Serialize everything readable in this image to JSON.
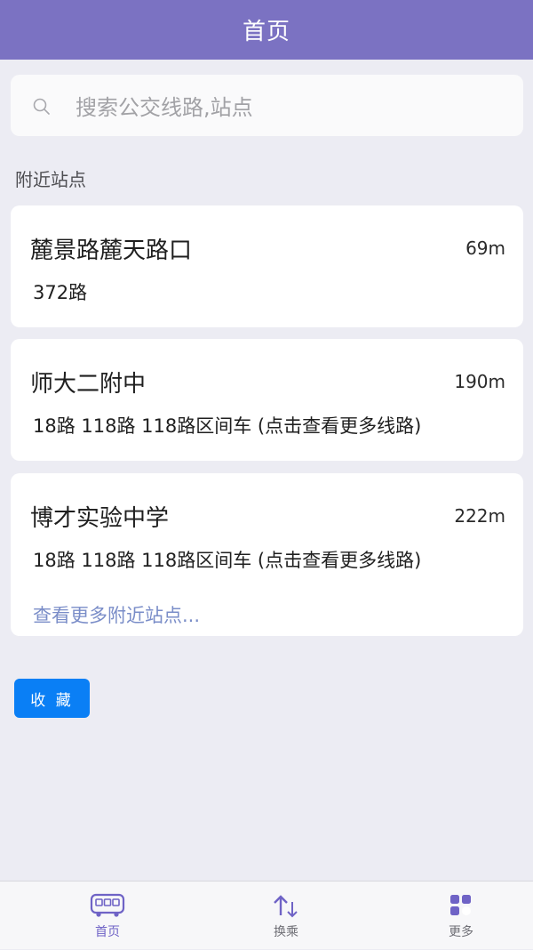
{
  "header": {
    "title": "首页"
  },
  "search": {
    "placeholder": "搜索公交线路,站点"
  },
  "nearby": {
    "section_label": "附近站点",
    "stops": [
      {
        "name": "麓景路麓天路口",
        "distance": "69m",
        "routes": "372路"
      },
      {
        "name": "师大二附中",
        "distance": "190m",
        "routes": "18路 118路 118路区间车 (点击查看更多线路)"
      },
      {
        "name": "博才实验中学",
        "distance": "222m",
        "routes": "18路 118路 118路区间车 (点击查看更多线路)"
      }
    ],
    "more_link": "查看更多附近站点..."
  },
  "favorite_button": "收 藏",
  "tabbar": {
    "tabs": [
      {
        "label": "首页",
        "icon": "bus-icon",
        "active": true
      },
      {
        "label": "换乘",
        "icon": "transfer-arrows-icon",
        "active": false
      },
      {
        "label": "更多",
        "icon": "more-grid-icon",
        "active": false
      }
    ]
  },
  "colors": {
    "header": "#7b72c2",
    "background": "#ececf3",
    "accent_button": "#0a7ff5",
    "link": "#7a8dc8",
    "tab_active": "#6f63c6"
  }
}
